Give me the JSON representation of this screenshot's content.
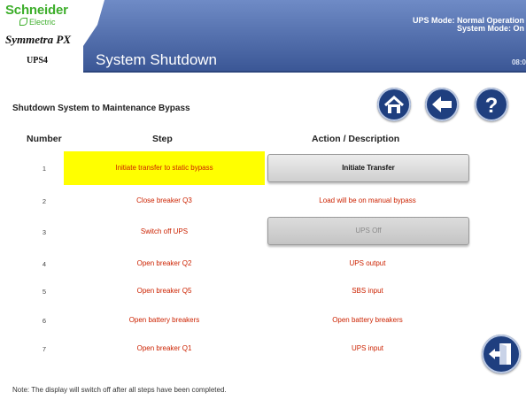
{
  "brand": {
    "name": "Schneider",
    "sub": "Electric",
    "model": "Symmetra PX",
    "unit": "UPS4"
  },
  "header": {
    "title": "System Shutdown",
    "ups_mode": "UPS Mode: Normal Operation",
    "system_mode": "System Mode: On",
    "time": "08:0"
  },
  "nav": {
    "home_icon": "home-icon",
    "back_icon": "back-arrow-icon",
    "help_icon": "help-icon"
  },
  "subtitle": "Shutdown System to Maintenance Bypass",
  "table": {
    "headers": [
      "Number",
      "Step",
      "Action / Description"
    ],
    "rows": [
      {
        "number": "1",
        "step": "Initiate transfer to static bypass",
        "action": "Initiate Transfer"
      },
      {
        "number": "2",
        "step": "Close breaker Q3",
        "action": "Load will be on manual bypass"
      },
      {
        "number": "3",
        "step": "Switch off UPS",
        "action": "UPS Off"
      },
      {
        "number": "4",
        "step": "Open breaker Q2",
        "action": "UPS output"
      },
      {
        "number": "5",
        "step": "Open breaker Q5",
        "action": "SBS input"
      },
      {
        "number": "6",
        "step": "Open battery breakers",
        "action": "Open battery breakers"
      },
      {
        "number": "7",
        "step": "Open breaker Q1",
        "action": "UPS input"
      }
    ]
  },
  "note": "Note: The display will switch off after all steps have been completed.",
  "exit_icon": "exit-door-icon",
  "colors": {
    "header_blue": "#4d6aa8",
    "highlight": "#ffff00",
    "step_text": "#cc2200",
    "brand_green": "#3dae2b"
  }
}
